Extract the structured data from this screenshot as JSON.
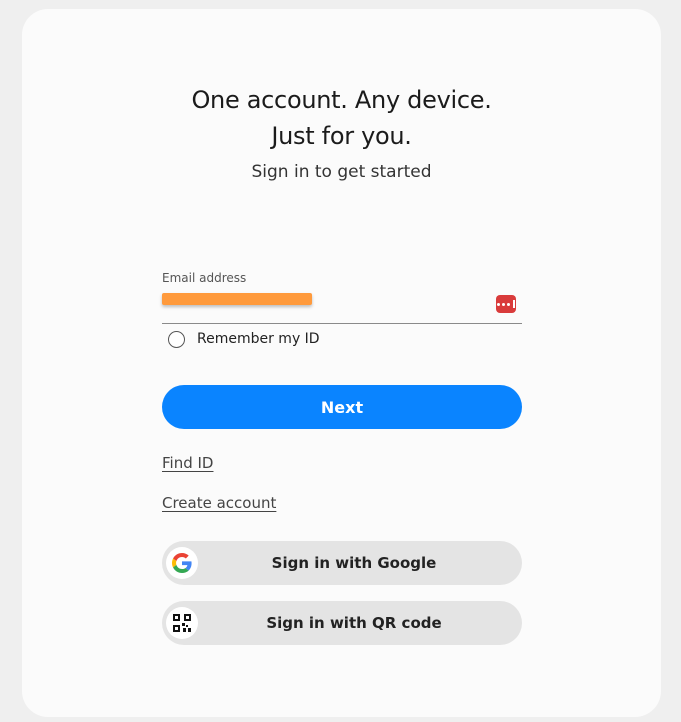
{
  "headline": {
    "line1": "One account. Any device.",
    "line2": "Just for you."
  },
  "subtitle": "Sign in to get started",
  "email_field": {
    "label": "Email address",
    "value": "",
    "redacted": true
  },
  "remember": {
    "label": "Remember my ID",
    "checked": false
  },
  "next_button": {
    "label": "Next"
  },
  "links": {
    "find_id": "Find ID",
    "create_account": "Create account"
  },
  "social": {
    "google": {
      "label": "Sign in with Google",
      "icon": "google-g-icon"
    },
    "qr": {
      "label": "Sign in with QR code",
      "icon": "qr-code-icon"
    }
  },
  "colors": {
    "accent": "#0a84ff",
    "card_background": "#fbfbfb",
    "page_background": "#efefef",
    "social_button": "#e4e4e4",
    "password_manager_icon": "#d93b3b",
    "redaction": "#ff9a3c"
  }
}
